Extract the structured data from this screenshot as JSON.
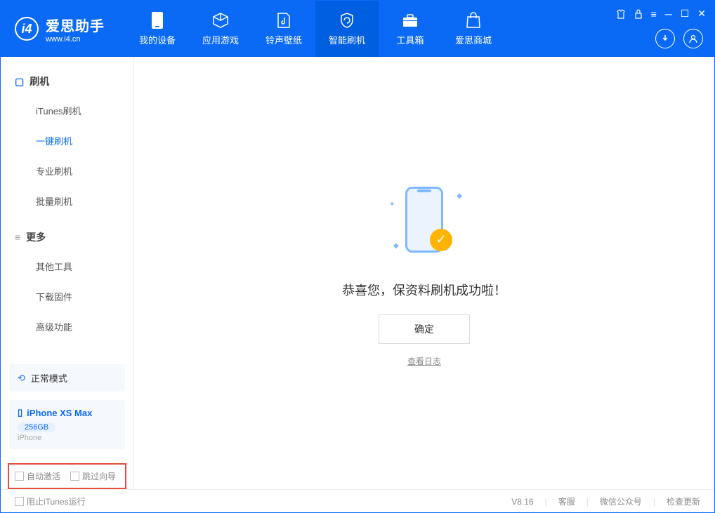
{
  "app": {
    "title": "爱思助手",
    "subtitle": "www.i4.cn"
  },
  "nav": {
    "items": [
      {
        "label": "我的设备"
      },
      {
        "label": "应用游戏"
      },
      {
        "label": "铃声壁纸"
      },
      {
        "label": "智能刷机"
      },
      {
        "label": "工具箱"
      },
      {
        "label": "爱思商城"
      }
    ]
  },
  "sidebar": {
    "section1_title": "刷机",
    "section1_items": [
      "iTunes刷机",
      "一键刷机",
      "专业刷机",
      "批量刷机"
    ],
    "section2_title": "更多",
    "section2_items": [
      "其他工具",
      "下载固件",
      "高级功能"
    ],
    "mode_label": "正常模式",
    "device_name": "iPhone XS Max",
    "device_storage": "256GB",
    "device_type": "iPhone",
    "checkbox1": "自动激活",
    "checkbox2": "跳过向导"
  },
  "content": {
    "success_message": "恭喜您，保资料刷机成功啦！",
    "ok_button": "确定",
    "view_log": "查看日志"
  },
  "footer": {
    "block_itunes": "阻止iTunes运行",
    "version": "V8.16",
    "link1": "客服",
    "link2": "微信公众号",
    "link3": "检查更新"
  }
}
